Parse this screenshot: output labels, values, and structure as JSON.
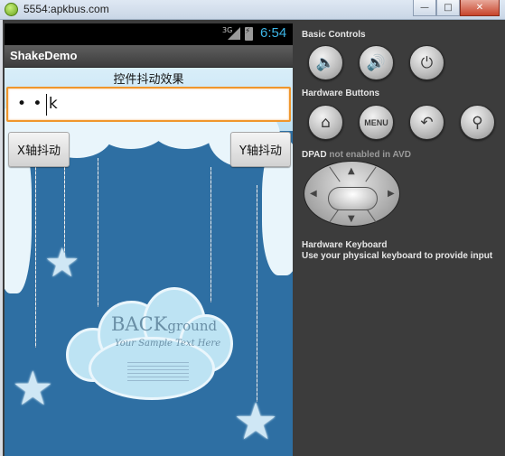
{
  "window": {
    "title": "5554:apkbus.com",
    "buttons": {
      "minimize": "—",
      "maximize": "□",
      "close": "✕"
    }
  },
  "status_bar": {
    "network": "3G",
    "time": "6:54"
  },
  "app": {
    "name": "ShakeDemo",
    "heading": "控件抖动效果",
    "input_value": "• • k",
    "x_button": "X轴抖动",
    "y_button": "Y轴抖动",
    "background_title": "BACK",
    "background_title_suffix": "ground",
    "background_subtitle": "Your Sample Text Here"
  },
  "controls": {
    "basic_title": "Basic Controls",
    "hardware_title": "Hardware Buttons",
    "menu_label": "MENU",
    "dpad_title": "DPAD",
    "dpad_note": "not enabled in AVD",
    "keyboard_title": "Hardware Keyboard",
    "keyboard_note": "Use your physical keyboard to provide input"
  },
  "icons": {
    "volume_down": "volume-down-icon",
    "volume_up": "volume-up-icon",
    "power": "power-icon",
    "home": "home-icon",
    "back": "back-icon",
    "search": "search-icon"
  }
}
